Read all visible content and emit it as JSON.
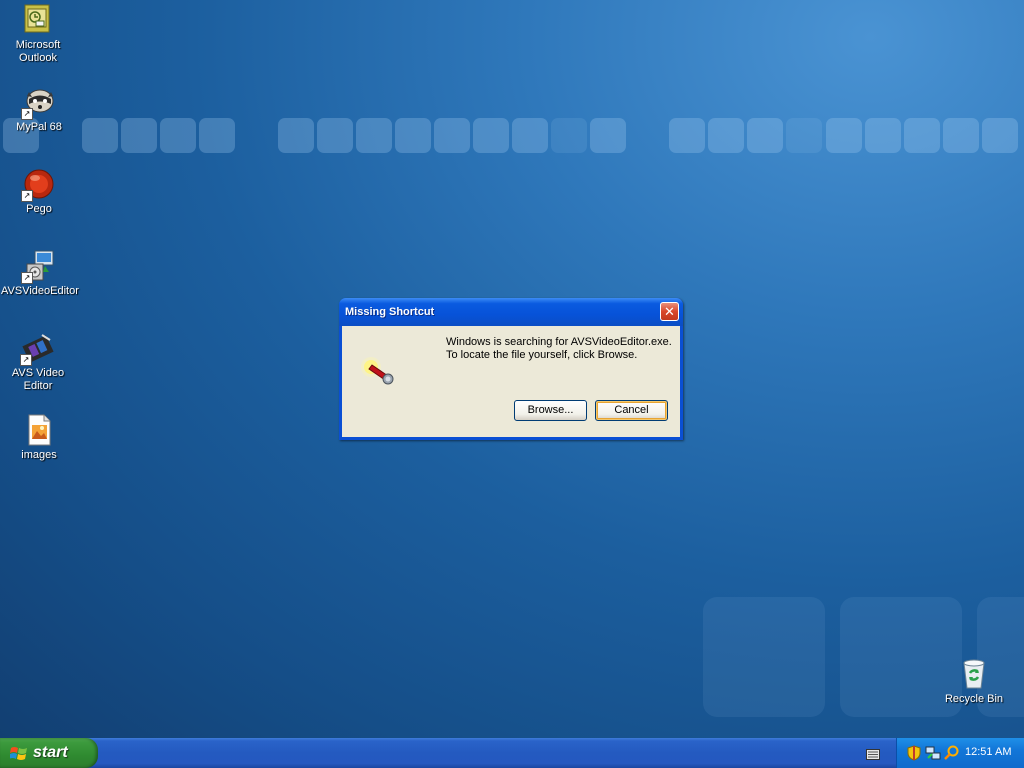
{
  "desktop": {
    "icons": [
      {
        "label_line1": "Microsoft",
        "label_line2": "Outlook",
        "icon": "outlook-icon"
      },
      {
        "label_line1": "MyPal 68",
        "label_line2": "",
        "icon": "raccoon-icon"
      },
      {
        "label_line1": "Pego",
        "label_line2": "",
        "icon": "pego-icon"
      },
      {
        "label_line1": "AVSVideoEditor",
        "label_line2": "",
        "icon": "installer-icon"
      },
      {
        "label_line1": "AVS Video",
        "label_line2": "Editor",
        "icon": "film-icon"
      },
      {
        "label_line1": "images",
        "label_line2": "",
        "icon": "image-file-icon"
      }
    ],
    "recycle_bin": {
      "label": "Recycle Bin",
      "icon": "recycle-bin-icon"
    }
  },
  "dialog": {
    "title": "Missing Shortcut",
    "close_label": "✕",
    "message_line1": "Windows is searching for AVSVideoEditor.exe.",
    "message_line2": "To locate the file yourself, click Browse.",
    "browse_label": "Browse...",
    "cancel_label": "Cancel"
  },
  "taskbar": {
    "start_label": "start",
    "clock": "12:51 AM"
  },
  "colors": {
    "desktop": "#1c5f9f",
    "titlebar": "#0752d8",
    "dialog_body": "#ece9d8",
    "start_green": "#3c9a3d",
    "taskbar_blue": "#245ac0",
    "tray_blue": "#1276d8"
  }
}
